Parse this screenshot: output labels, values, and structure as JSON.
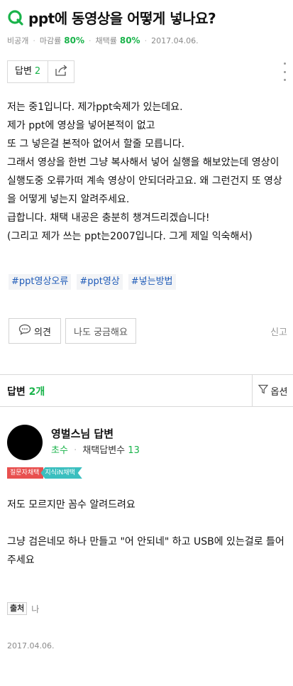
{
  "question": {
    "title": "ppt에 동영상을 어떻게 넣나요?",
    "icon": "question-q-icon",
    "meta": {
      "visibility": "비공개",
      "deadline_label": "마감률",
      "deadline_rate": "80%",
      "adopt_label": "채택률",
      "adopt_rate": "80%",
      "date": "2017.04.06."
    },
    "answer_box": {
      "label": "답변",
      "count": "2"
    },
    "body": [
      "저는 중1입니다. 제가ppt숙제가 있는데요.",
      "제가 ppt에 영상을 넣어본적이 없고",
      "또 그 넣은걸 본적아 없어서 할줄 모릅니다.",
      "그래서 영상을 한번 그냥 복사해서 넣어 실행을 해보았는데 영상이 실행도중 오류가떠 계속 영상이 안되더라고요. 왜 그런건지 또 영상을 어떻게 넣는지 알려주세요.",
      "급합니다. 채택 내공은 충분히 챙겨드리겠습니다!",
      "(그리고 제가 쓰는 ppt는2007입니다. 그게 제일 익숙해서)"
    ],
    "tags": [
      "#ppt영상오류",
      "#ppt영상",
      "#넣는방법"
    ],
    "actions": {
      "opinion": "의견",
      "curious": "나도 궁금해요",
      "report": "신고"
    }
  },
  "answers_header": {
    "label": "답변",
    "count": "2개",
    "sort_label": "옵션"
  },
  "answer": {
    "author": "영벌스님 답변",
    "rank": "초수",
    "adopt_count_label": "채택답변수",
    "adopt_count": "13",
    "badges": [
      "질문자채택",
      "지식iN채택"
    ],
    "body": [
      "저도 모르지만 꼼수 알려드려요",
      "",
      "그냥 검은네모 하나 만들고 \"어 안되네\" 하고 USB에 있는걸로 틀어주세요"
    ],
    "source_label": "출처",
    "source_value": "나",
    "date": "2017.04.06."
  },
  "colors": {
    "accent_green": "#19b34a",
    "tag_blue": "#1f5bb8",
    "badge_red": "#e8504f",
    "badge_teal": "#3bbfbf"
  }
}
